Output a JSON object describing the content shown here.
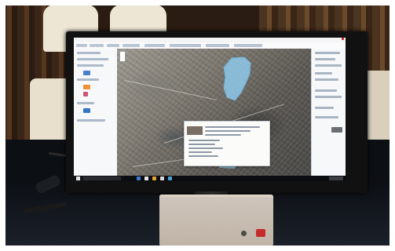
{
  "scene": {
    "subject": "monitor",
    "screen_app": "map",
    "colors": {
      "map_water": "#8ec9ea",
      "panel_accent": "#2f6fc0",
      "legend_swatch_a": "#3d78c8",
      "legend_swatch_b": "#ed8c2b",
      "legend_swatch_c": "#c94c6a",
      "taskbar": "#0b0c10",
      "stand_base": "#cbbfb2",
      "sticker": "#c52b2b"
    },
    "icons": {
      "start": "windows-start-icon",
      "search": "search-icon",
      "close": "close-icon"
    }
  }
}
